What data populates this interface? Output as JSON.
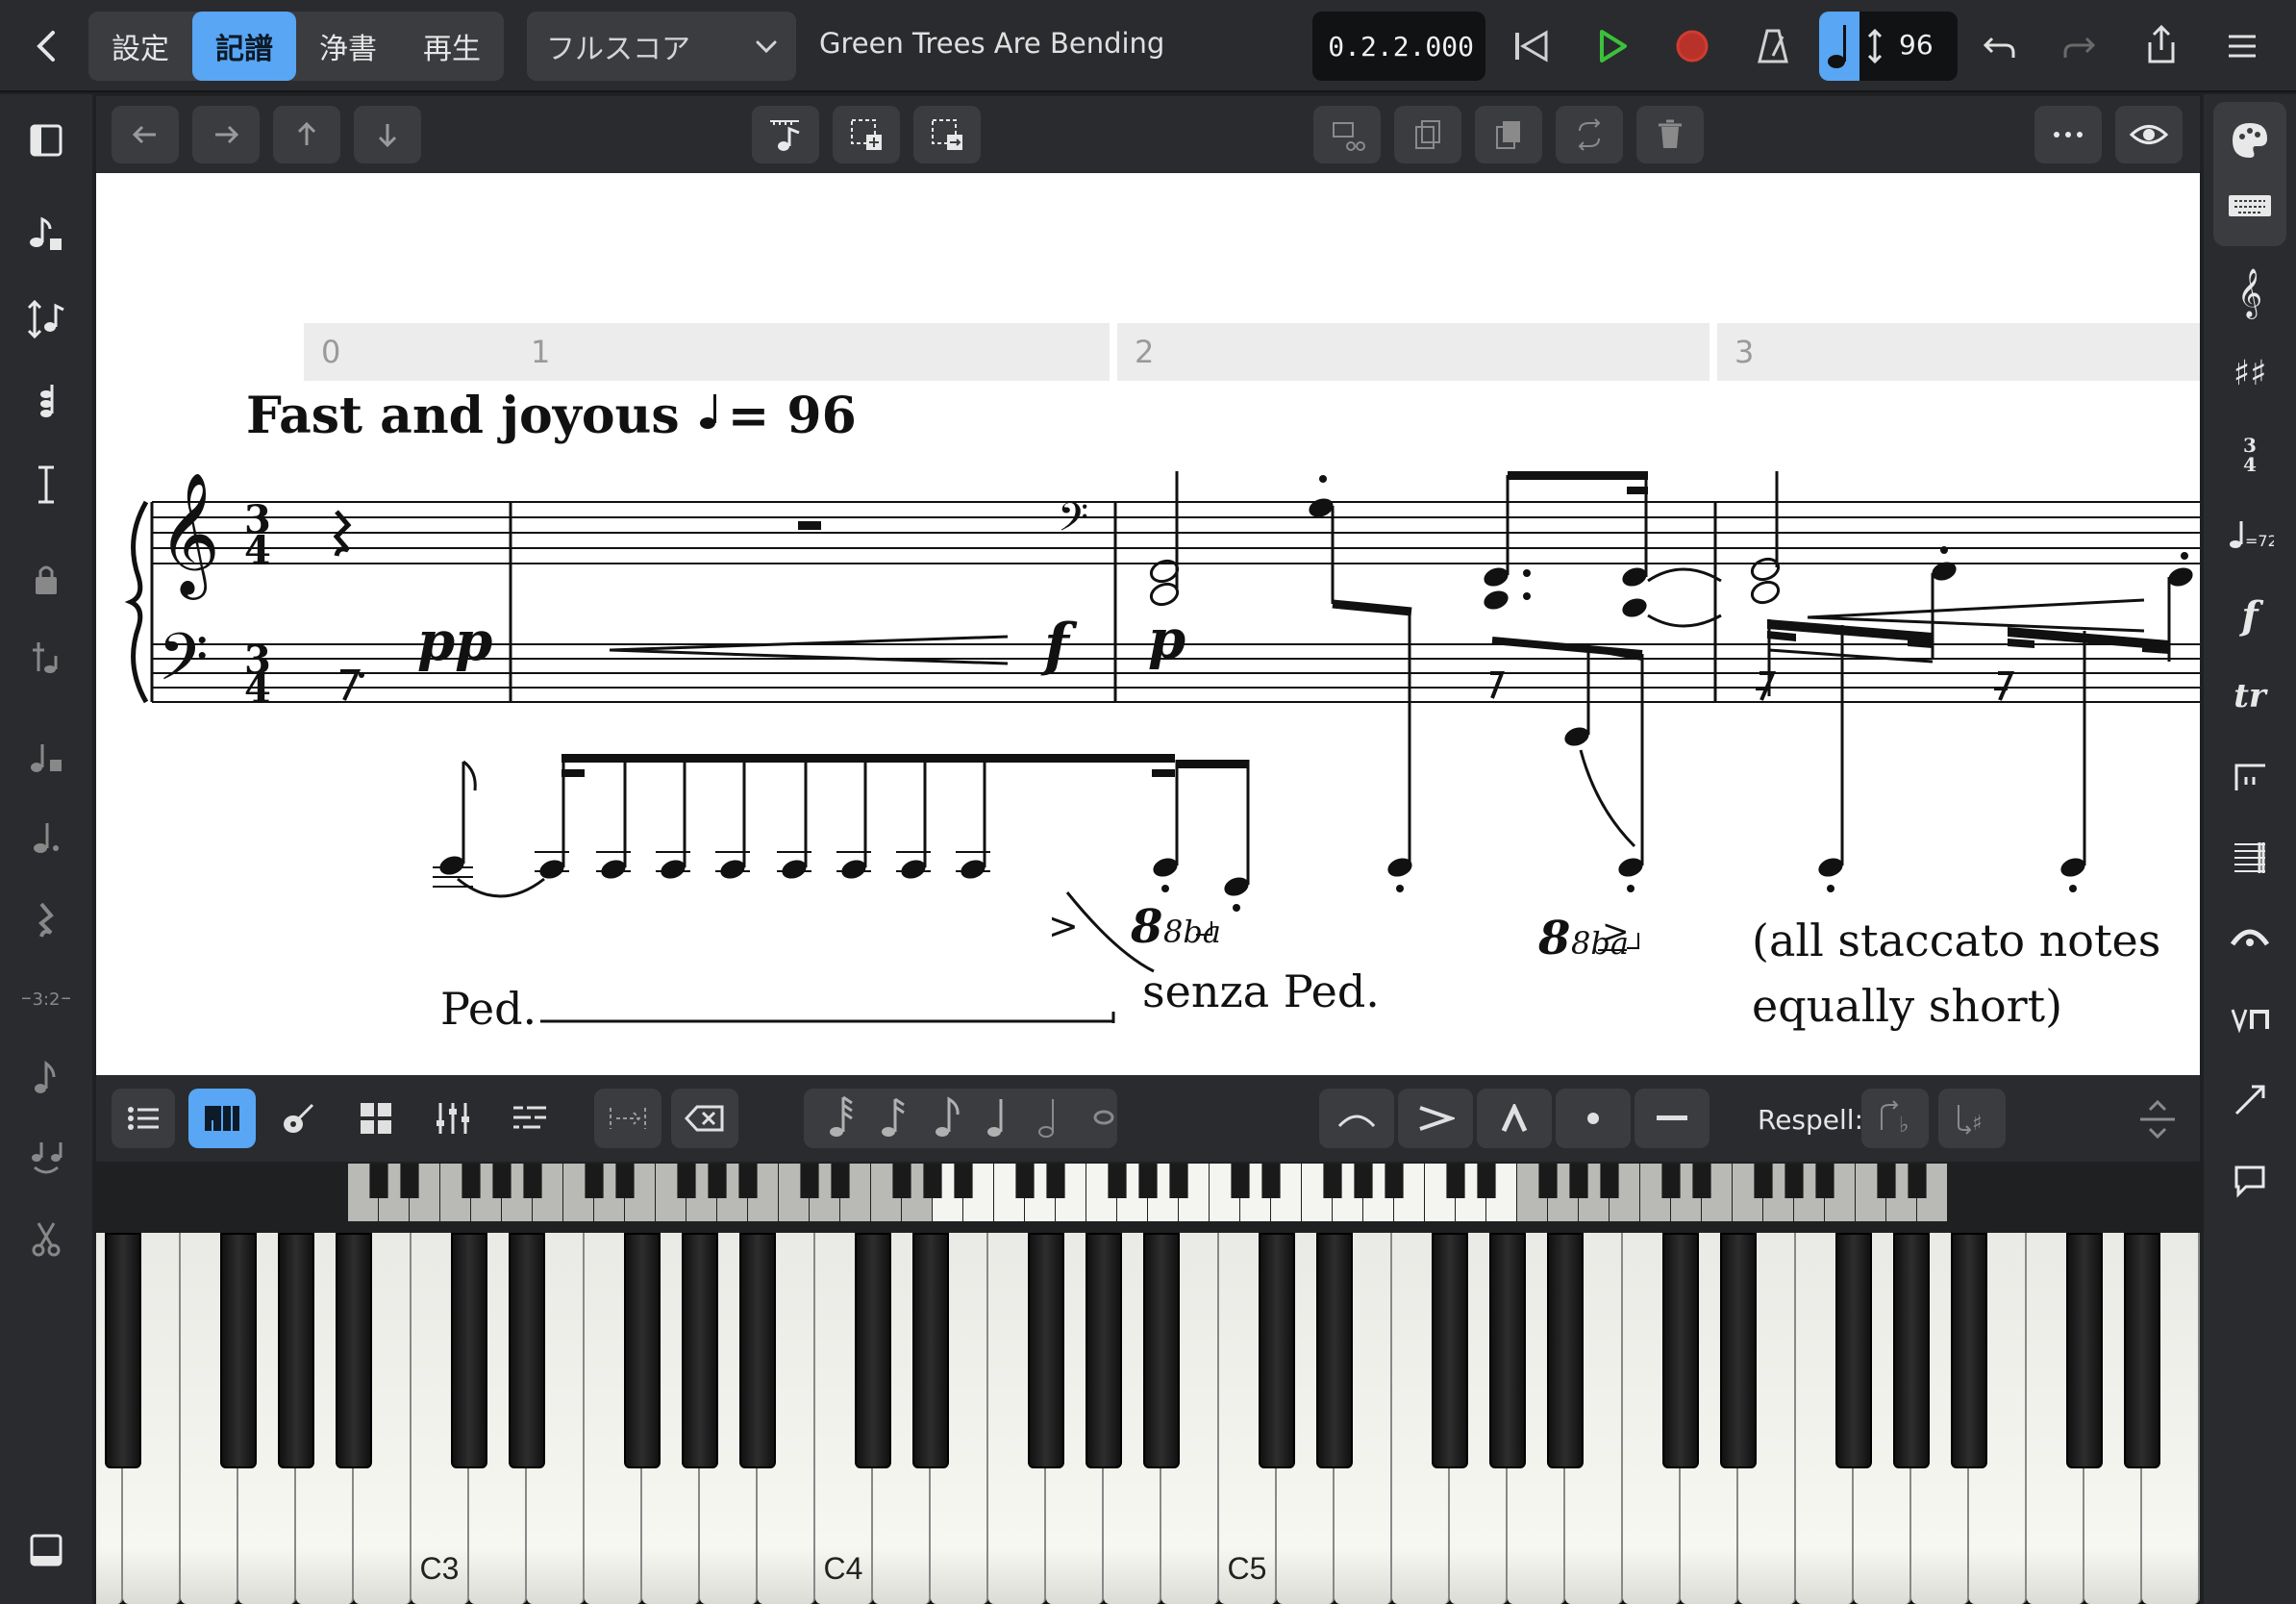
{
  "topbar": {
    "back_icon": "chevron-left-icon",
    "modes": [
      {
        "label": "設定",
        "active": false
      },
      {
        "label": "記譜",
        "active": true
      },
      {
        "label": "浄書",
        "active": false
      },
      {
        "label": "再生",
        "active": false
      }
    ],
    "layout_select": "フルスコア",
    "project_title": "Green Trees Are Bending",
    "position": "0.2.2.000",
    "tempo": "96",
    "accent": "#58a6f4",
    "play_color": "#3bc13b",
    "record_color": "#d23b2f"
  },
  "score": {
    "bar_numbers": [
      "0",
      "1",
      "2",
      "3"
    ],
    "tempo_text": "Fast and joyous",
    "tempo_equals": "= 96",
    "dynamics": {
      "pp": "pp",
      "f": "f",
      "p": "p"
    },
    "ottava1": "8ba",
    "ottava2": "8ba",
    "accent1": ">",
    "accent2": ">",
    "pedal": "Ped.",
    "senza": "senza Ped.",
    "text_line1": "(all staccato notes",
    "text_line2": "equally short)"
  },
  "bottombar": {
    "respell_label": "Respell:"
  },
  "keyboard": {
    "labels": [
      "C3",
      "C4",
      "C5"
    ]
  }
}
